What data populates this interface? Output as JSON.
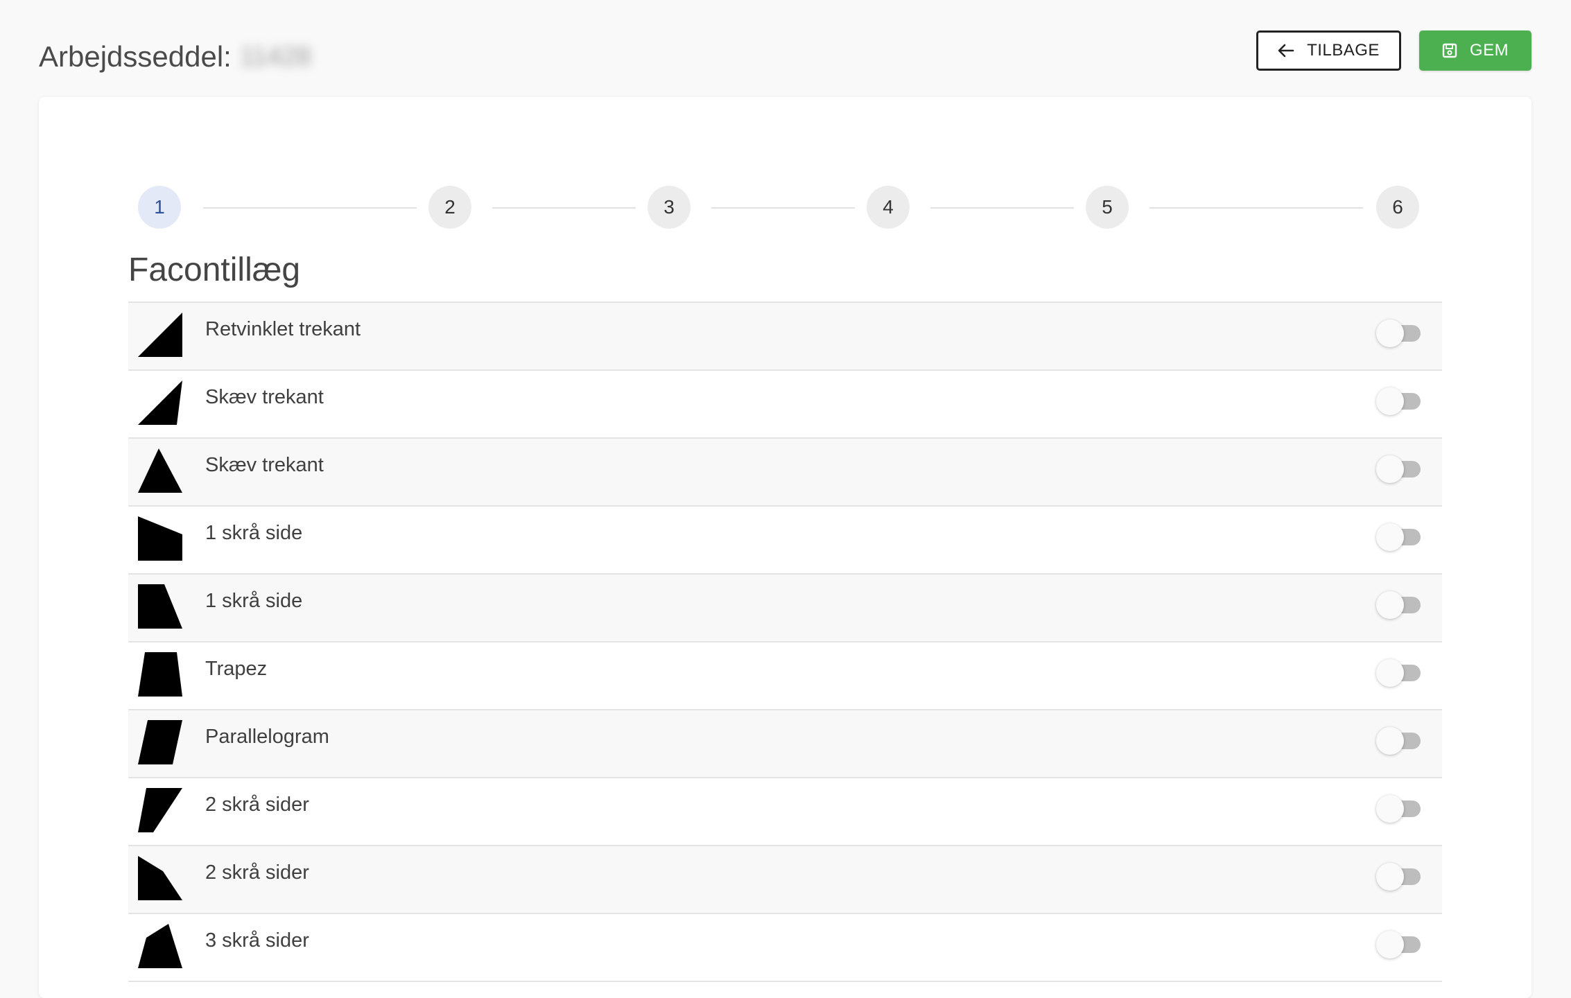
{
  "header": {
    "title": "Arbejdsseddel:",
    "work_order_number": "11428",
    "back_label": "TILBAGE",
    "save_label": "GEM",
    "save_color": "#4caf50"
  },
  "stepper": {
    "steps": [
      "1",
      "2",
      "3",
      "4",
      "5",
      "6"
    ],
    "active_step": "1",
    "active_color": "#e3e9f6"
  },
  "section": {
    "title": "Facontillæg"
  },
  "items": [
    {
      "label": "Retvinklet trekant",
      "icon": "right-triangle-icon",
      "enabled": false
    },
    {
      "label": "Skæv trekant",
      "icon": "skewed-triangle-icon",
      "enabled": false
    },
    {
      "label": "Skæv trekant",
      "icon": "triangle-icon",
      "enabled": false
    },
    {
      "label": "1 skrå side",
      "icon": "one-slanted-side-icon",
      "enabled": false
    },
    {
      "label": "1 skrå side",
      "icon": "one-slanted-side-alt-icon",
      "enabled": false
    },
    {
      "label": "Trapez",
      "icon": "trapezoid-icon",
      "enabled": false
    },
    {
      "label": "Parallelogram",
      "icon": "parallelogram-icon",
      "enabled": false
    },
    {
      "label": "2 skrå sider",
      "icon": "two-slanted-sides-icon",
      "enabled": false
    },
    {
      "label": "2 skrå sider",
      "icon": "two-slanted-sides-alt-icon",
      "enabled": false
    },
    {
      "label": "3 skrå sider",
      "icon": "three-slanted-sides-icon",
      "enabled": false
    }
  ]
}
